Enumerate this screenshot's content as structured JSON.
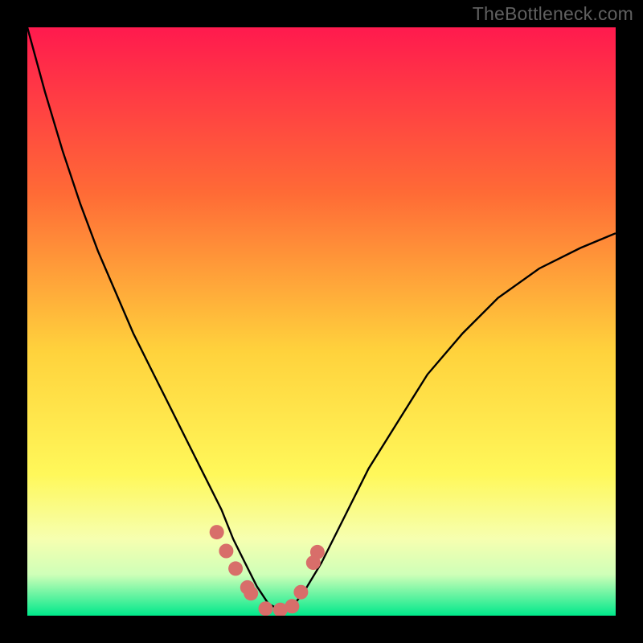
{
  "watermark": "TheBottleneck.com",
  "colors": {
    "bg": "#000000",
    "grad_top": "#ff1a4e",
    "grad_mid1": "#ff7a2d",
    "grad_mid2": "#ffe540",
    "grad_mid3": "#f8ff9e",
    "grad_bot1": "#d6ffb4",
    "grad_bot2": "#00e88b",
    "curve": "#000000",
    "marker": "#d86e6a"
  },
  "chart_data": {
    "type": "line",
    "title": "",
    "xlabel": "",
    "ylabel": "",
    "xlim": [
      0,
      100
    ],
    "ylim": [
      0,
      100
    ],
    "series": [
      {
        "name": "bottleneck-curve",
        "x": [
          0,
          3,
          6,
          9,
          12,
          15,
          18,
          21,
          24,
          27,
          30,
          33,
          35,
          37,
          39,
          41,
          43,
          45,
          47,
          50,
          54,
          58,
          63,
          68,
          74,
          80,
          87,
          94,
          100
        ],
        "y": [
          100,
          89,
          79,
          70,
          62,
          55,
          48,
          42,
          36,
          30,
          24,
          18,
          13,
          9,
          5,
          2,
          1,
          1.5,
          4,
          9,
          17,
          25,
          33,
          41,
          48,
          54,
          59,
          62.5,
          65
        ]
      }
    ],
    "markers": {
      "name": "highlight-dots",
      "x": [
        32.2,
        33.8,
        35.4,
        37.4,
        38.0,
        40.5,
        43.0,
        45.0,
        46.5,
        48.6,
        49.3
      ],
      "y": [
        14.2,
        11.0,
        8.0,
        4.8,
        3.8,
        1.2,
        1.0,
        1.6,
        4.0,
        9.0,
        10.8
      ]
    }
  }
}
